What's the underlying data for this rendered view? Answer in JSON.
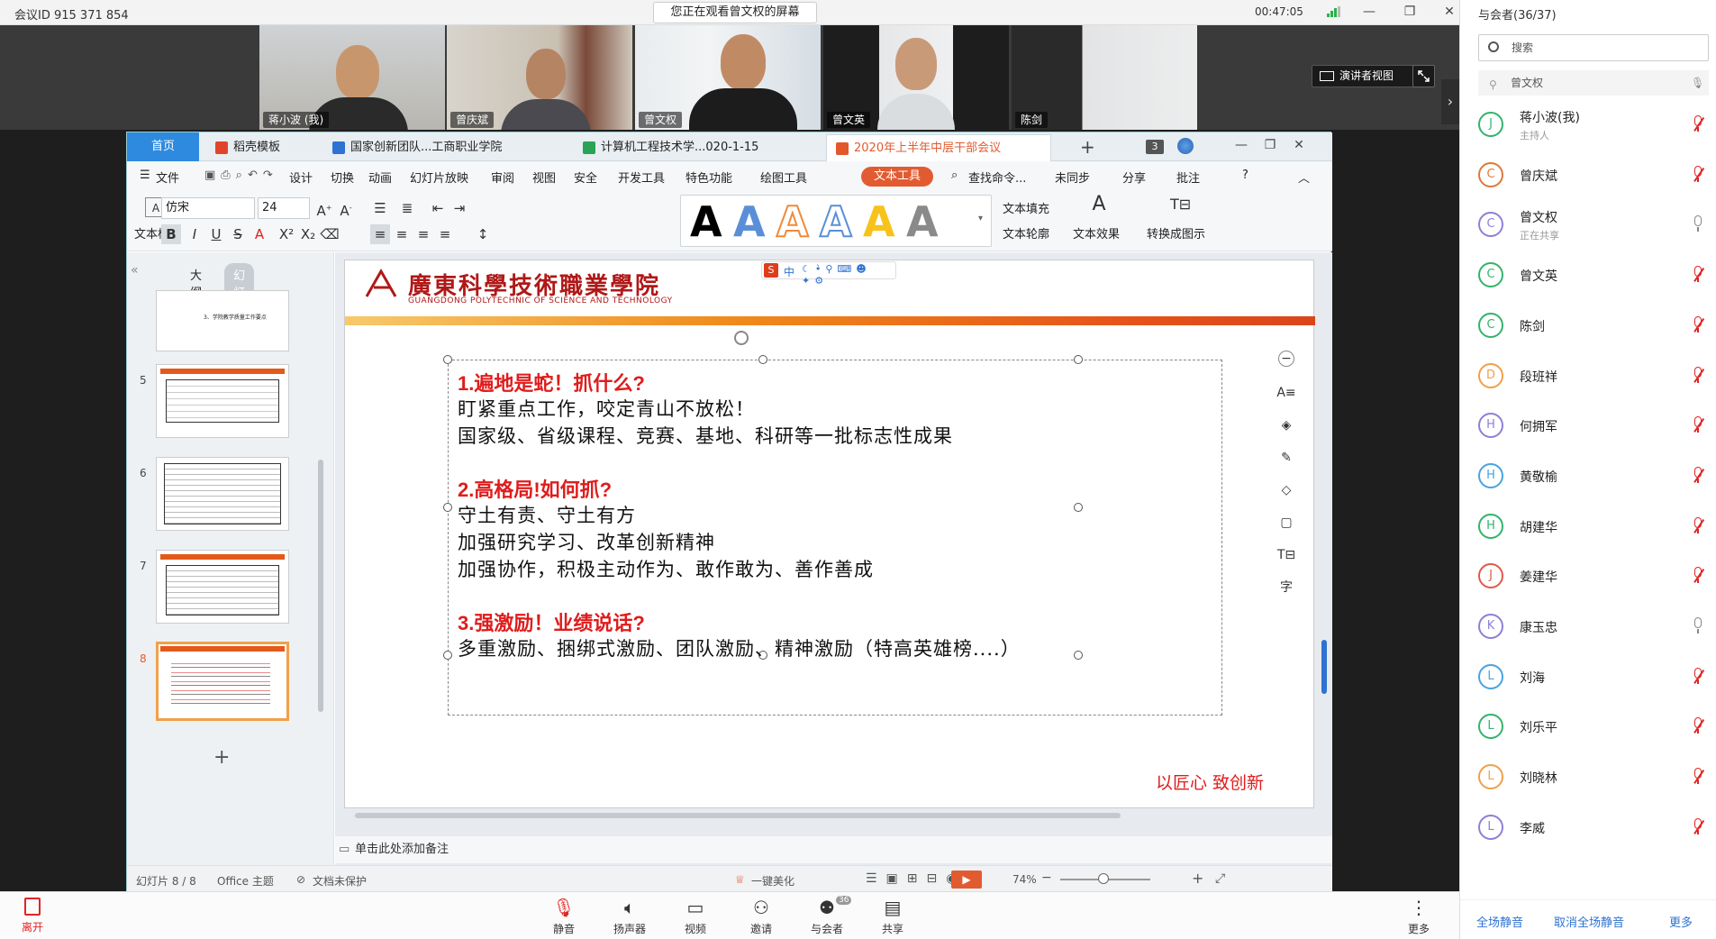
{
  "meeting": {
    "id_label": "会议ID 915 371 854",
    "watching": "您正在观看曾文权的屏幕",
    "timer": "00:47:05",
    "presenter_view": "演讲者视图"
  },
  "video_tiles": [
    {
      "name": "蒋小波 (我)"
    },
    {
      "name": "曾庆斌"
    },
    {
      "name": "曾文权"
    },
    {
      "name": "曾文英"
    },
    {
      "name": "陈剑"
    }
  ],
  "wps": {
    "tabs": [
      {
        "label": "首页"
      },
      {
        "label": "稻壳模板"
      },
      {
        "label": "国家创新团队...工商职业学院"
      },
      {
        "label": "计算机工程技术学...020-1-15"
      },
      {
        "label": "2020年上半年中层干部会议"
      }
    ],
    "tab_count": "3",
    "menu": [
      "文件",
      "设计",
      "切换",
      "动画",
      "幻灯片放映",
      "审阅",
      "视图",
      "安全",
      "开发工具",
      "特色功能",
      "绘图工具",
      "文本工具"
    ],
    "menu_right": {
      "search": "查找命令...",
      "sync": "未同步",
      "share": "分享",
      "comment": "批注"
    },
    "ribbon": {
      "textbox_label": "文本框",
      "font": "仿宋",
      "size": "24",
      "fill": "文本填充",
      "outline": "文本轮廓",
      "effect": "文本效果",
      "convert": "转换成图示"
    },
    "panel_tabs": {
      "outline": "大纲",
      "slides": "幻灯片"
    },
    "thumb_numbers": [
      "5",
      "6",
      "7",
      "8"
    ],
    "thumb_top_text": "3、学院教学质量工作要点",
    "slide": {
      "college_cn": "廣東科學技術職業學院",
      "college_en": "GUANGDONG POLYTECHNIC OF SCIENCE AND TECHNOLOGY",
      "ime": "中",
      "sections": [
        {
          "heading": "1.遍地是蛇！抓什么?",
          "lines": [
            "盯紧重点工作，咬定青山不放松！",
            "国家级、省级课程、竞赛、基地、科研等一批标志性成果"
          ]
        },
        {
          "heading": "2.高格局!如何抓?",
          "lines": [
            "守土有责、守土有方",
            "加强研究学习、改革创新精神",
            "加强协作，积极主动作为、敢作敢为、善作善成"
          ]
        },
        {
          "heading": "3.强激励！业绩说话?",
          "lines": [
            "多重激励、捆绑式激励、团队激励、精神激励（特高英雄榜....）"
          ]
        }
      ],
      "slogan": "以匠心 致创新"
    },
    "notes": "单击此处添加备注",
    "status": {
      "slide_count": "幻灯片 8 / 8",
      "theme": "Office 主题",
      "protect": "文档未保护",
      "beautify": "一键美化",
      "zoom": "74%"
    }
  },
  "bottom": {
    "leave": "离开",
    "buttons": [
      {
        "label": "静音"
      },
      {
        "label": "扬声器"
      },
      {
        "label": "视频"
      },
      {
        "label": "邀请"
      },
      {
        "label": "与会者",
        "badge": "36"
      },
      {
        "label": "共享"
      },
      {
        "label": "更多"
      }
    ]
  },
  "sidebar": {
    "title": "与会者(36/37)",
    "search": "搜索",
    "sharing_row": "曾文权",
    "participants": [
      {
        "name": "蒋小波(我)",
        "sub": "主持人",
        "initial": "J",
        "color": "#34b36b",
        "muted": true
      },
      {
        "name": "曾庆斌",
        "sub": "",
        "initial": "C",
        "color": "#e0783a",
        "muted": true
      },
      {
        "name": "曾文权",
        "sub": "正在共享",
        "initial": "C",
        "color": "#8f7fd6",
        "muted": false
      },
      {
        "name": "曾文英",
        "sub": "",
        "initial": "C",
        "color": "#34b36b",
        "muted": true
      },
      {
        "name": "陈剑",
        "sub": "",
        "initial": "C",
        "color": "#34b36b",
        "muted": true
      },
      {
        "name": "段班祥",
        "sub": "",
        "initial": "D",
        "color": "#f0a04a",
        "muted": true
      },
      {
        "name": "何拥军",
        "sub": "",
        "initial": "H",
        "color": "#8f7fd6",
        "muted": true
      },
      {
        "name": "黄敬榆",
        "sub": "",
        "initial": "H",
        "color": "#4aa3e0",
        "muted": true
      },
      {
        "name": "胡建华",
        "sub": "",
        "initial": "H",
        "color": "#34b36b",
        "muted": true
      },
      {
        "name": "姜建华",
        "sub": "",
        "initial": "J",
        "color": "#e05a4a",
        "muted": true
      },
      {
        "name": "康玉忠",
        "sub": "",
        "initial": "K",
        "color": "#8f7fd6",
        "muted": false
      },
      {
        "name": "刘海",
        "sub": "",
        "initial": "L",
        "color": "#4aa3e0",
        "muted": true
      },
      {
        "name": "刘乐平",
        "sub": "",
        "initial": "L",
        "color": "#34b36b",
        "muted": true
      },
      {
        "name": "刘晓林",
        "sub": "",
        "initial": "L",
        "color": "#f0a04a",
        "muted": true
      },
      {
        "name": "李威",
        "sub": "",
        "initial": "L",
        "color": "#8f7fd6",
        "muted": true
      }
    ],
    "footer": {
      "mute_all": "全场静音",
      "unmute_all": "取消全场静音",
      "more": "更多"
    }
  }
}
